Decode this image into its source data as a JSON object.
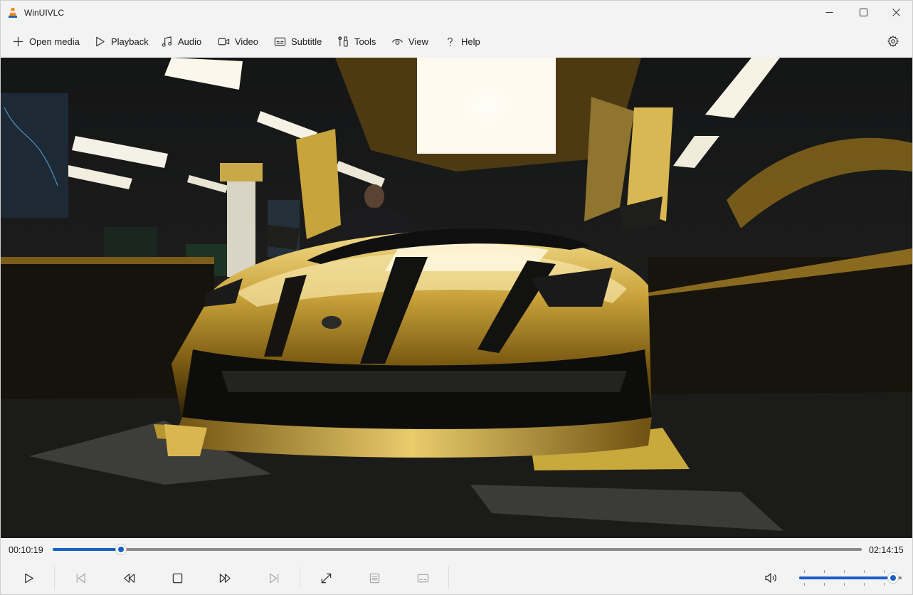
{
  "window": {
    "title": "WinUIVLC",
    "controls": [
      "minimize-icon",
      "maximize-icon",
      "close-icon"
    ]
  },
  "menu": {
    "items": [
      {
        "label": "Open media",
        "icon": "plus-icon"
      },
      {
        "label": "Playback",
        "icon": "play-outline-icon"
      },
      {
        "label": "Audio",
        "icon": "music-note-icon"
      },
      {
        "label": "Video",
        "icon": "video-camera-icon"
      },
      {
        "label": "Subtitle",
        "icon": "subtitle-icon"
      },
      {
        "label": "Tools",
        "icon": "tools-icon"
      },
      {
        "label": "View",
        "icon": "eye-icon"
      },
      {
        "label": "Help",
        "icon": "question-mark-icon"
      }
    ],
    "settings_icon": "gear-icon"
  },
  "video": {
    "content": "golden supercar in garage"
  },
  "playback": {
    "current_time": "00:10:19",
    "total_time": "02:14:15",
    "progress": 0.0845,
    "volume": 0.92
  },
  "controls": [
    "play-icon",
    "previous-icon",
    "rewind-icon",
    "stop-icon",
    "fast-forward-icon",
    "next-icon",
    "fullscreen-icon",
    "chapters-icon",
    "subtitles-toggle-icon",
    "volume-icon"
  ],
  "colors": {
    "accent": "#1a5fc7",
    "background": "#f3f3f3"
  }
}
